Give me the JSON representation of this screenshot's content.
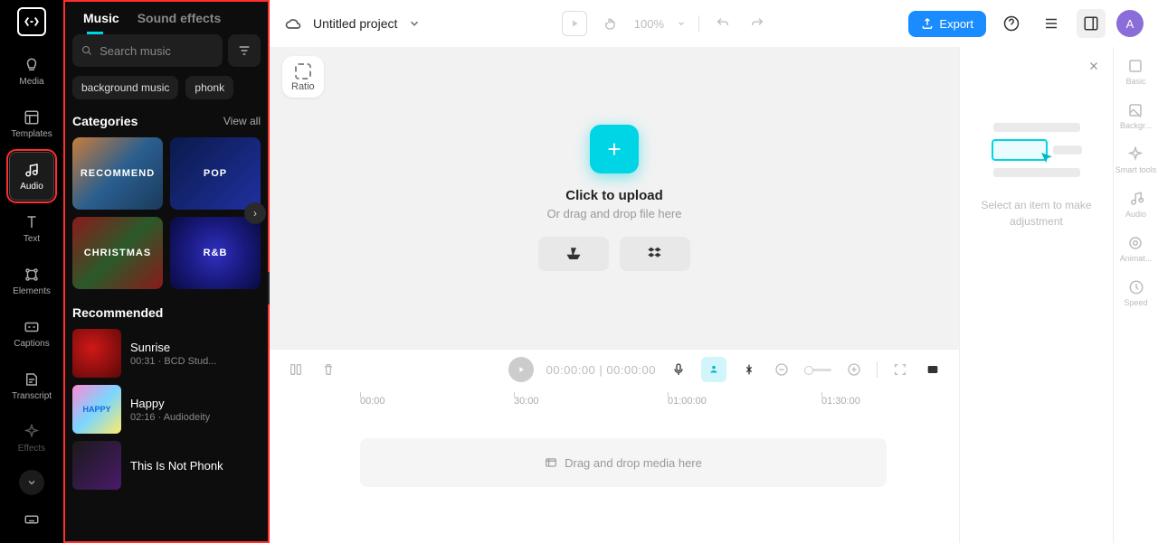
{
  "nav": {
    "items": [
      {
        "label": "Media"
      },
      {
        "label": "Templates"
      },
      {
        "label": "Audio"
      },
      {
        "label": "Text"
      },
      {
        "label": "Elements"
      },
      {
        "label": "Captions"
      },
      {
        "label": "Transcript"
      },
      {
        "label": "Effects"
      }
    ]
  },
  "audio_panel": {
    "tabs": {
      "music": "Music",
      "sound_effects": "Sound effects"
    },
    "search_placeholder": "Search music",
    "tags": [
      "background music",
      "phonk"
    ],
    "categories_title": "Categories",
    "view_all": "View all",
    "categories": [
      {
        "label": "RECOMMEND"
      },
      {
        "label": "POP"
      },
      {
        "label": "CHRISTMAS"
      },
      {
        "label": "R&B"
      }
    ],
    "recommended_title": "Recommended",
    "tracks": [
      {
        "title": "Sunrise",
        "duration": "00:31",
        "artist": "BCD Stud..."
      },
      {
        "title": "Happy",
        "duration": "02:16",
        "artist": "Audiodeity"
      },
      {
        "title": "This Is Not Phonk",
        "duration": "",
        "artist": ""
      }
    ]
  },
  "topbar": {
    "project_title": "Untitled project",
    "zoom": "100%",
    "export": "Export",
    "avatar": "A"
  },
  "canvas": {
    "ratio": "Ratio",
    "upload_title": "Click to upload",
    "upload_sub": "Or drag and drop file here"
  },
  "timeline": {
    "time_current": "00:00:00",
    "time_total": "00:00:00",
    "marks": [
      "00:00",
      "30:00",
      "01:00:00",
      "01:30:00"
    ],
    "drop_hint": "Drag and drop media here"
  },
  "inspector": {
    "hint": "Select an item to make adjustment",
    "rail": [
      {
        "label": "Basic"
      },
      {
        "label": "Backgr..."
      },
      {
        "label": "Smart tools"
      },
      {
        "label": "Audio"
      },
      {
        "label": "Animat..."
      },
      {
        "label": "Speed"
      }
    ]
  }
}
